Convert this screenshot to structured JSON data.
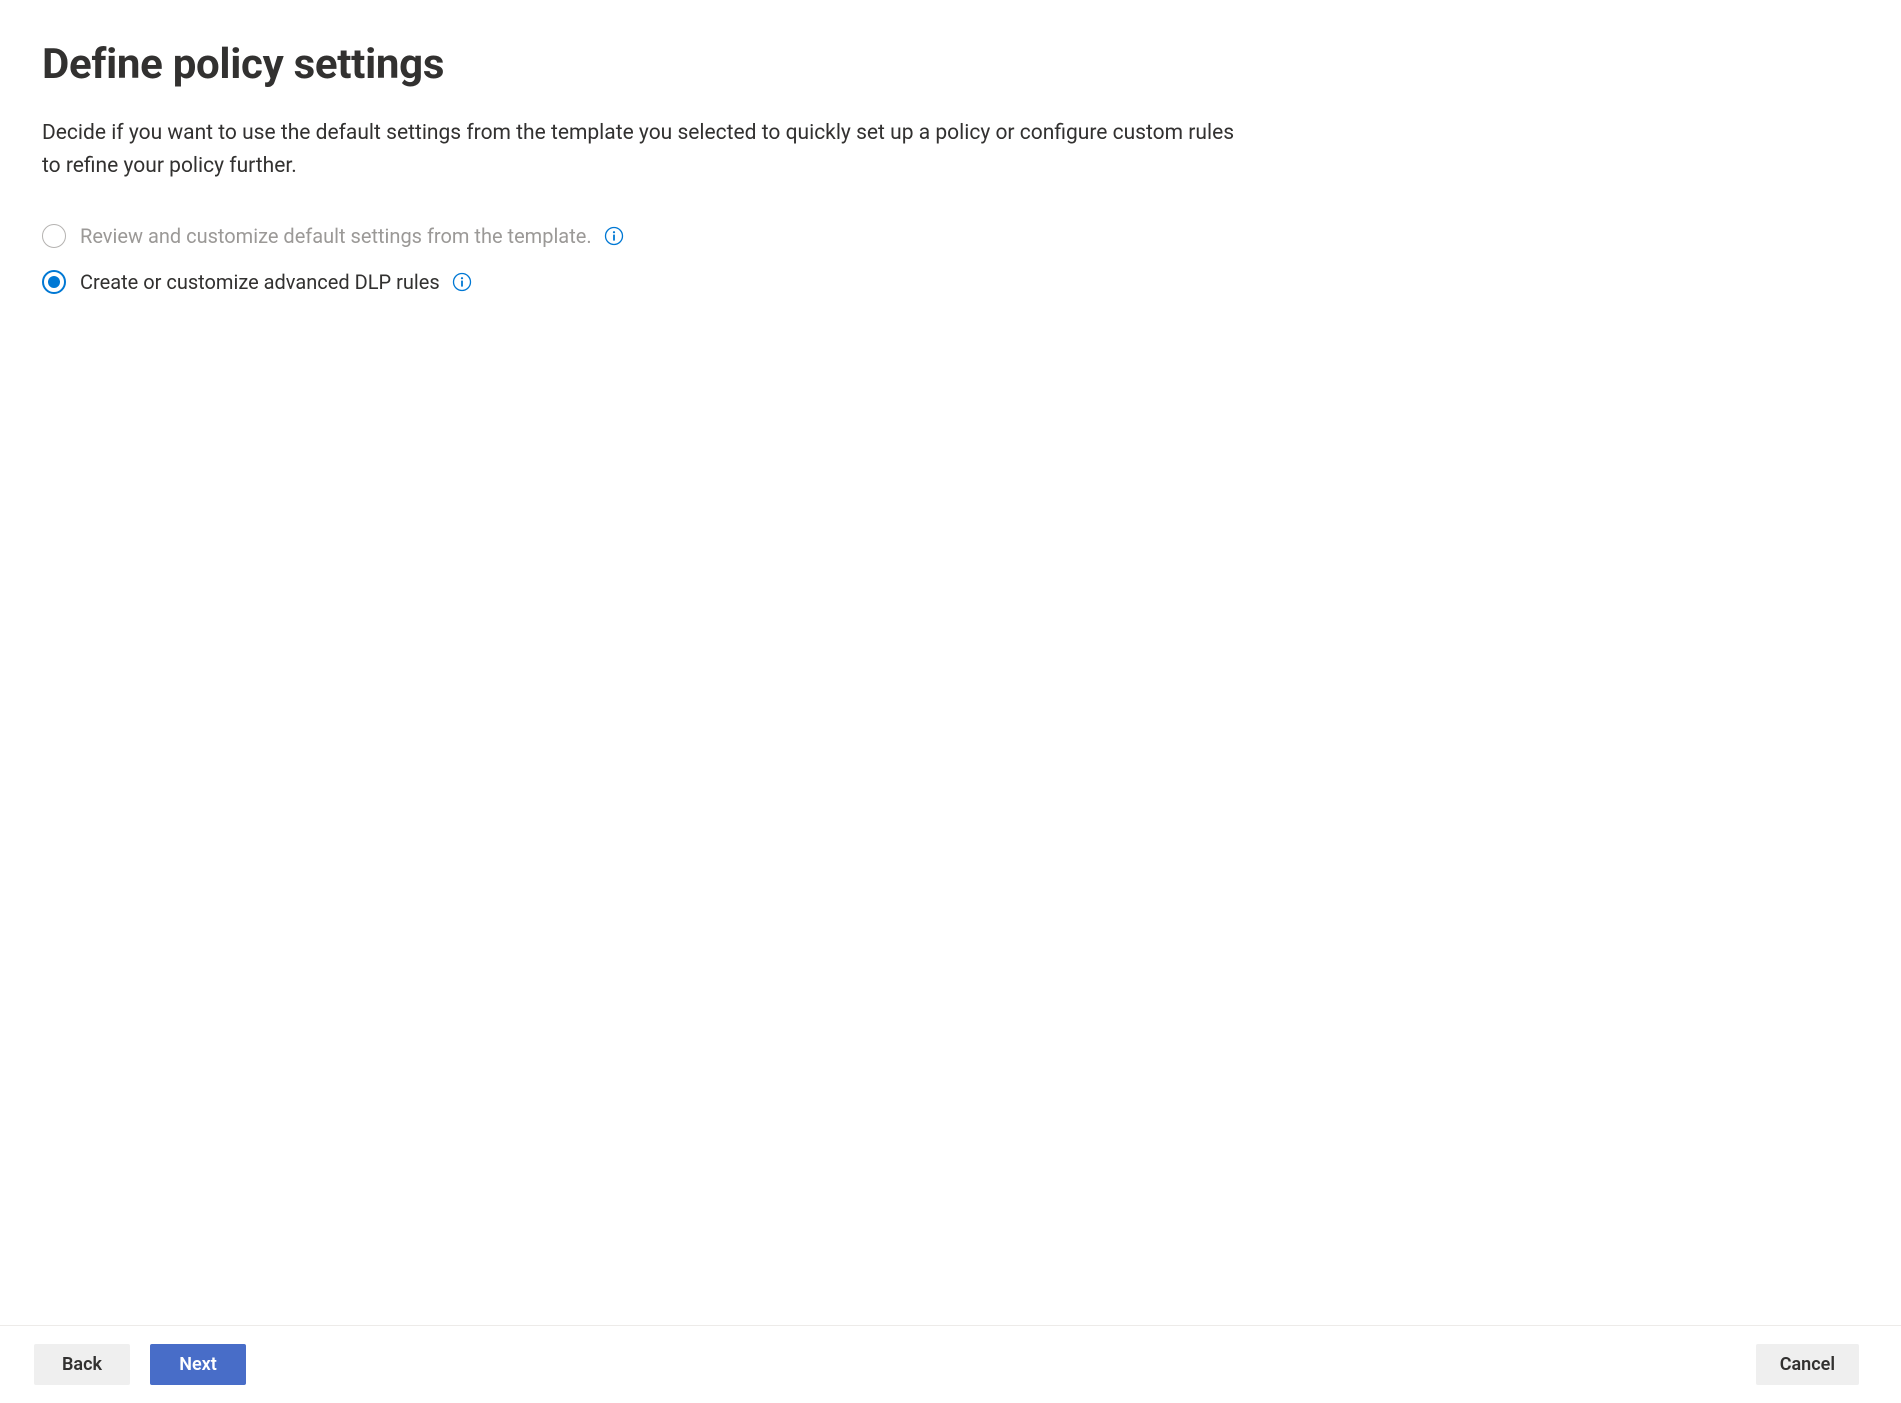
{
  "header": {
    "title": "Define policy settings",
    "description": "Decide if you want to use the default settings from the template you selected to quickly set up a policy or configure custom rules to refine your policy further."
  },
  "options": {
    "item0": {
      "label": "Review and customize default settings from the template.",
      "selected": false,
      "disabled": true
    },
    "item1": {
      "label": "Create or customize advanced DLP rules",
      "selected": true,
      "disabled": false
    }
  },
  "footer": {
    "back_label": "Back",
    "next_label": "Next",
    "cancel_label": "Cancel"
  },
  "colors": {
    "primary": "#0078d4",
    "next_button": "#486dc8",
    "text": "#323130",
    "disabled_text": "#9b9997",
    "secondary_bg": "#efefef"
  }
}
